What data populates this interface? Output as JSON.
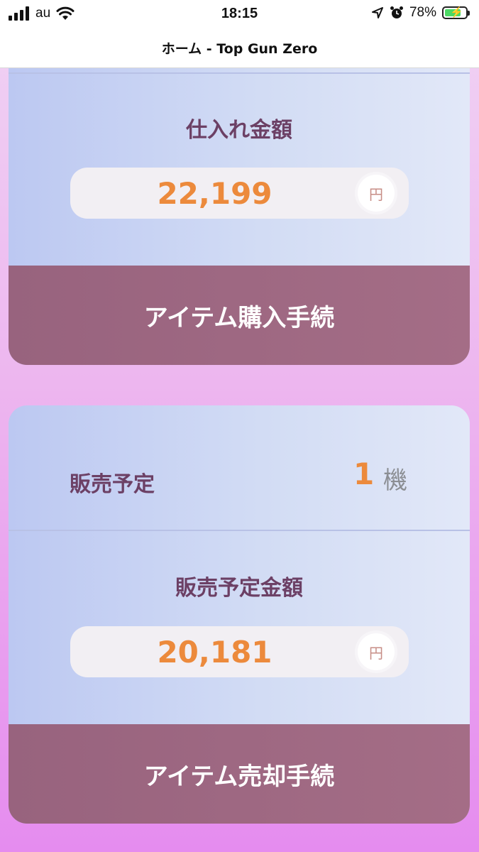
{
  "status_bar": {
    "carrier": "au",
    "time": "18:15",
    "battery": "78%"
  },
  "nav": {
    "title": "ホーム - Top Gun Zero"
  },
  "purchase": {
    "title": "仕入れ金額",
    "amount": "22,199",
    "unit": "円",
    "button": "アイテム購入手続"
  },
  "sale": {
    "planned_label": "販売予定",
    "planned_count": "1",
    "planned_unit": "機",
    "amount_title": "販売予定金額",
    "amount": "20,181",
    "unit": "円",
    "button": "アイテム売却手続"
  },
  "colors": {
    "accent_orange": "#ec8a3c",
    "title_purple": "#6c4065",
    "button_mauve": "#9e6882"
  },
  "icons": [
    "signal-icon",
    "wifi-icon",
    "location-icon",
    "alarm-icon",
    "battery-icon"
  ]
}
